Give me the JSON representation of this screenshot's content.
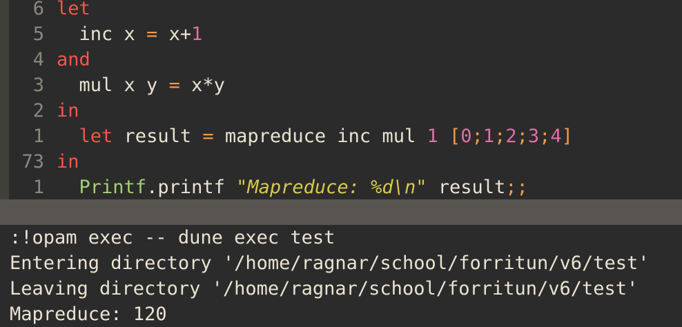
{
  "editor": {
    "lines": [
      {
        "num": "6",
        "tokens": [
          {
            "t": "let",
            "c": "kw"
          }
        ]
      },
      {
        "num": "5",
        "tokens": [
          {
            "t": "  inc x ",
            "c": "id"
          },
          {
            "t": "=",
            "c": "op"
          },
          {
            "t": " x",
            "c": "id"
          },
          {
            "t": "+",
            "c": "id"
          },
          {
            "t": "1",
            "c": "num"
          }
        ]
      },
      {
        "num": "4",
        "tokens": [
          {
            "t": "and",
            "c": "kw"
          }
        ]
      },
      {
        "num": "3",
        "tokens": [
          {
            "t": "  mul x y ",
            "c": "id"
          },
          {
            "t": "=",
            "c": "op"
          },
          {
            "t": " x",
            "c": "id"
          },
          {
            "t": "*",
            "c": "id"
          },
          {
            "t": "y",
            "c": "id"
          }
        ]
      },
      {
        "num": "2",
        "tokens": [
          {
            "t": "in",
            "c": "kw"
          }
        ]
      },
      {
        "num": "1",
        "tokens": [
          {
            "t": "  ",
            "c": "id"
          },
          {
            "t": "let",
            "c": "kw"
          },
          {
            "t": " result ",
            "c": "id"
          },
          {
            "t": "=",
            "c": "op"
          },
          {
            "t": " mapreduce inc mul ",
            "c": "id"
          },
          {
            "t": "1",
            "c": "num"
          },
          {
            "t": " ",
            "c": "id"
          },
          {
            "t": "[",
            "c": "br"
          },
          {
            "t": "0",
            "c": "num"
          },
          {
            "t": ";",
            "c": "semi"
          },
          {
            "t": "1",
            "c": "num"
          },
          {
            "t": ";",
            "c": "semi"
          },
          {
            "t": "2",
            "c": "num"
          },
          {
            "t": ";",
            "c": "semi"
          },
          {
            "t": "3",
            "c": "num"
          },
          {
            "t": ";",
            "c": "semi"
          },
          {
            "t": "4",
            "c": "num"
          },
          {
            "t": "]",
            "c": "br"
          }
        ]
      },
      {
        "num": "73",
        "tokens": [
          {
            "t": "in",
            "c": "kw"
          }
        ]
      },
      {
        "num": "1",
        "tokens": [
          {
            "t": "  ",
            "c": "id"
          },
          {
            "t": "Printf",
            "c": "mod"
          },
          {
            "t": ".printf ",
            "c": "id"
          },
          {
            "t": "\"Mapreduce: %d\\n\"",
            "c": "str"
          },
          {
            "t": " result",
            "c": "id"
          },
          {
            "t": ";;",
            "c": "semi"
          }
        ]
      }
    ]
  },
  "command_output": {
    "lines": [
      ":!opam exec -- dune exec test",
      "Entering directory '/home/ragnar/school/forritun/v6/test'",
      "Leaving directory '/home/ragnar/school/forritun/v6/test'",
      "Mapreduce: 120"
    ]
  },
  "colors": {
    "background": "#2b2b2b",
    "keyword": "#f2574b",
    "operator": "#f39a4c",
    "number": "#e06ea5",
    "module": "#a6cf71",
    "string": "#d7c94d",
    "line_number": "#8b887f",
    "cursor_line": "#585550"
  }
}
